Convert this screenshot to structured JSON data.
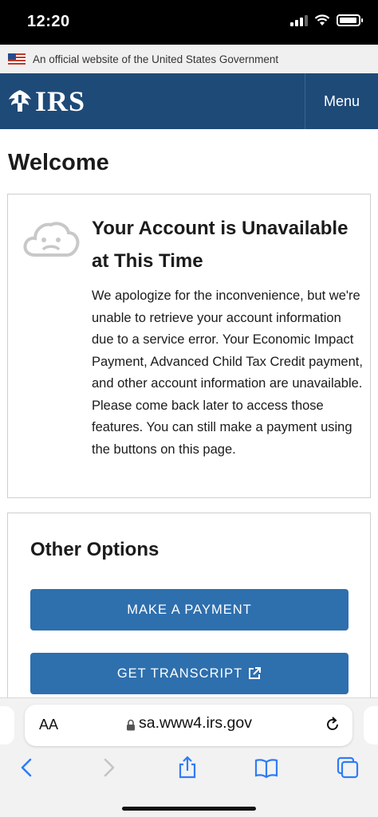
{
  "status_bar": {
    "time": "12:20"
  },
  "gov_banner": {
    "text": "An official website of the United States Government"
  },
  "header": {
    "logo_text": "IRS",
    "menu_label": "Menu"
  },
  "page": {
    "title": "Welcome"
  },
  "account_card": {
    "title": "Your Account is Unavailable at This Time",
    "body": "We apologize for the inconvenience, but we're unable to retrieve your account information due to a service error. Your Economic Impact Payment, Advanced Child Tax Credit payment, and other account information are unavailable. Please come back later to access those features. You can still make a payment using the buttons on this page."
  },
  "options_card": {
    "title": "Other Options",
    "buttons": [
      {
        "label": "MAKE A PAYMENT"
      },
      {
        "label": "GET TRANSCRIPT"
      }
    ]
  },
  "browser": {
    "text_size_label": "AA",
    "url": "sa.www4.irs.gov"
  },
  "colors": {
    "header": "#1e4a78",
    "button": "#2e6fae"
  }
}
